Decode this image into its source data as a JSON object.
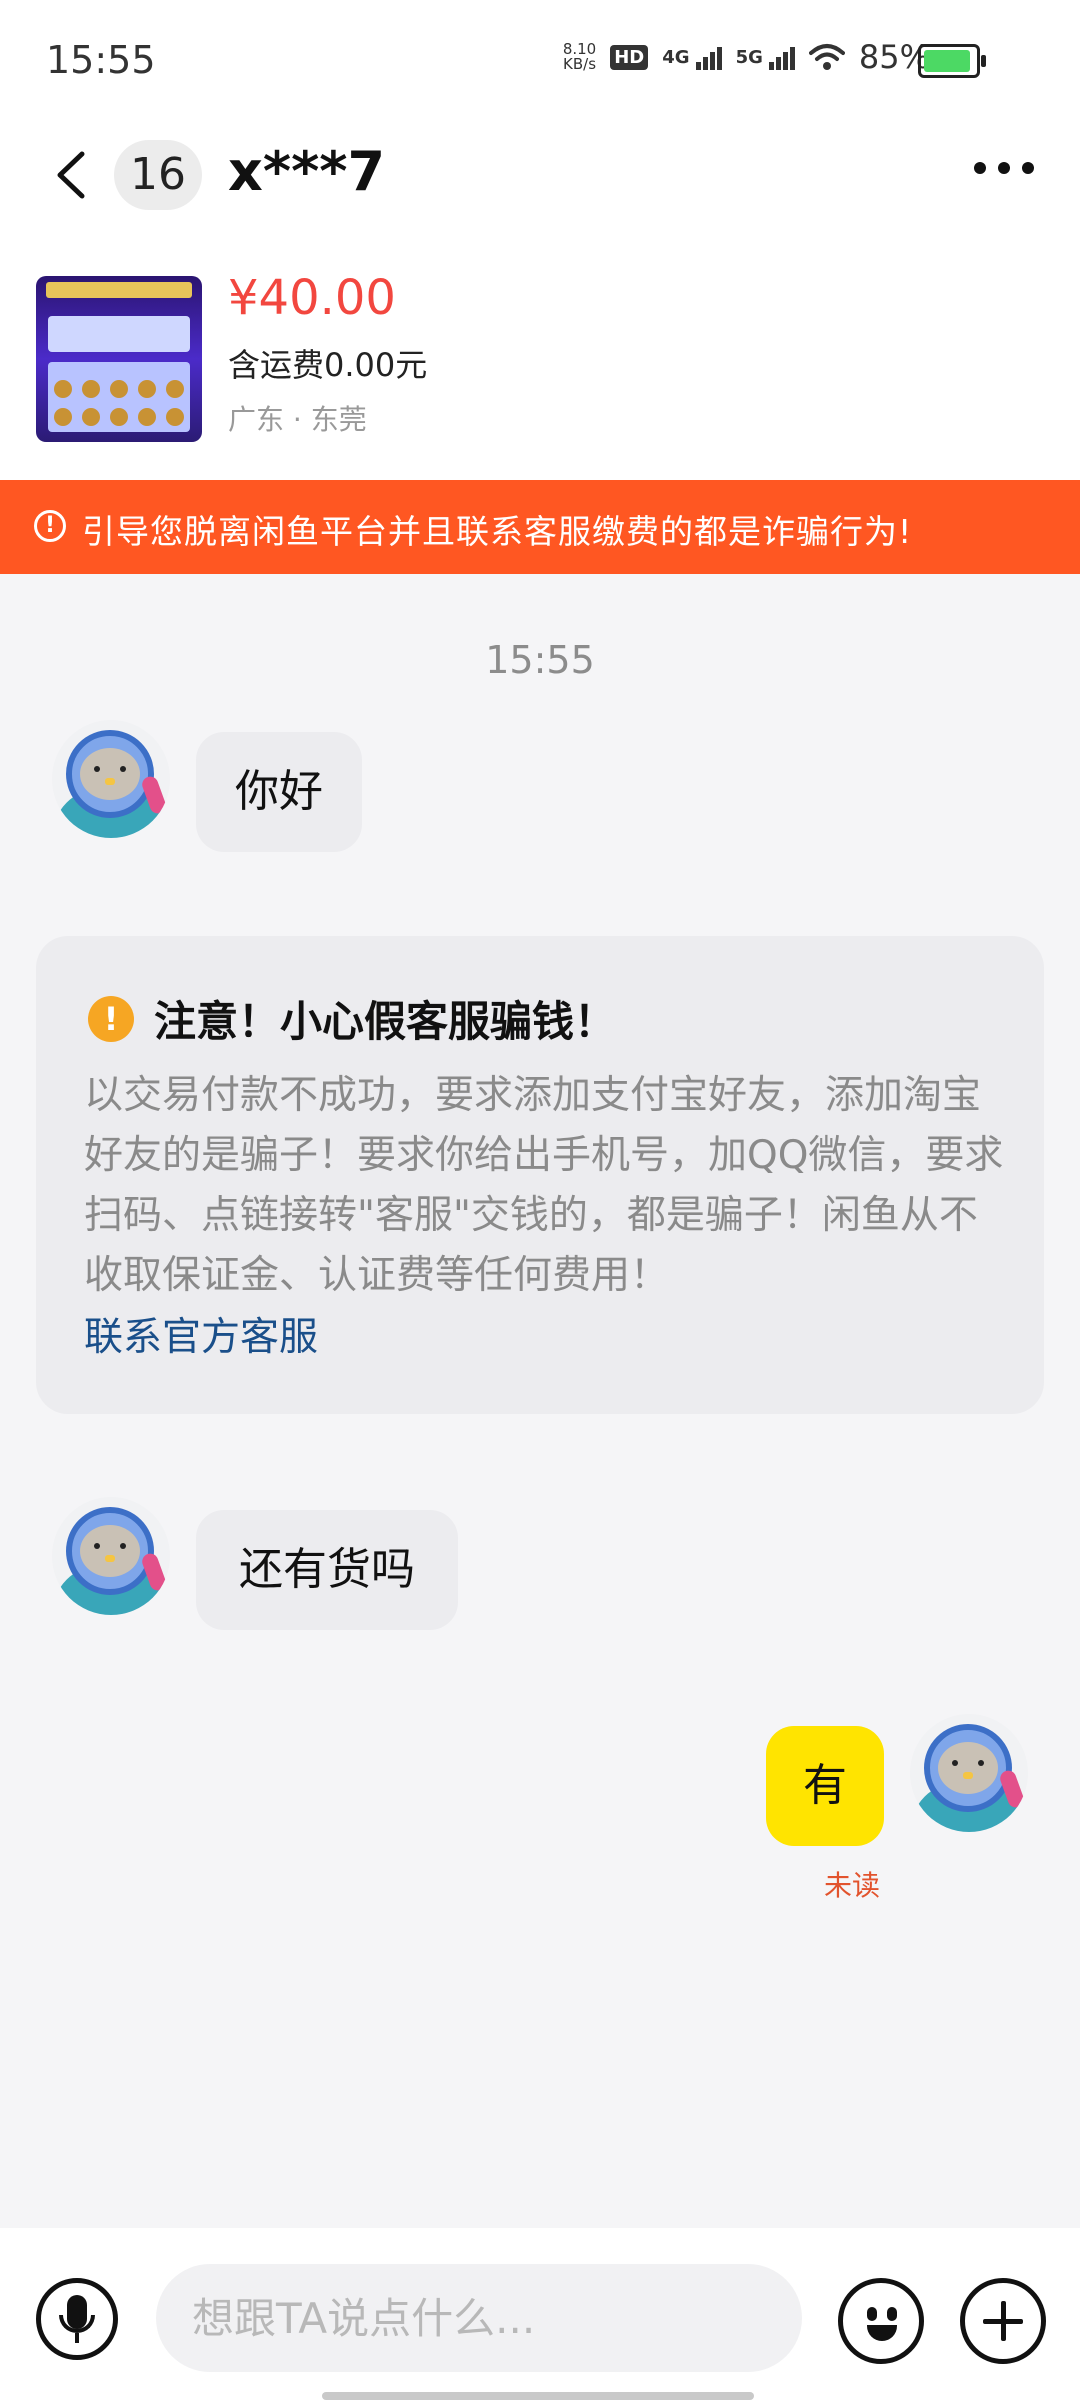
{
  "status_bar": {
    "time": "15:55",
    "net_speed_value": "8.10",
    "net_speed_unit": "KB/s",
    "hd_badge": "HD",
    "signal_1": "4G",
    "signal_2": "5G",
    "battery": "85%"
  },
  "header": {
    "unread_count": "16",
    "title": "x***7"
  },
  "product": {
    "price": "¥40.00",
    "shipping": "含运费0.00元",
    "location": "广东 · 东莞"
  },
  "warning_banner": {
    "text": "引导您脱离闲鱼平台并且联系客服缴费的都是诈骗行为!"
  },
  "chat": {
    "timestamp": "15:55",
    "messages": [
      {
        "from": "them",
        "text": "你好"
      },
      {
        "from": "them",
        "text": "还有货吗"
      },
      {
        "from": "me",
        "text": "有",
        "status": "未读"
      }
    ]
  },
  "notice": {
    "title": "注意！小心假客服骗钱！",
    "body": "以交易付款不成功，要求添加支付宝好友，添加淘宝好友的是骗子！要求你给出手机号，加QQ微信，要求扫码、点链接转\"客服\"交钱的，都是骗子！闲鱼从不收取保证金、认证费等任何费用！",
    "link": "联系官方客服"
  },
  "composer": {
    "placeholder": "想跟TA说点什么..."
  },
  "colors": {
    "accent_yellow": "#ffe400",
    "warning_orange": "#ff5722",
    "price_red": "#f2473f",
    "link_blue": "#1a4f8a"
  }
}
